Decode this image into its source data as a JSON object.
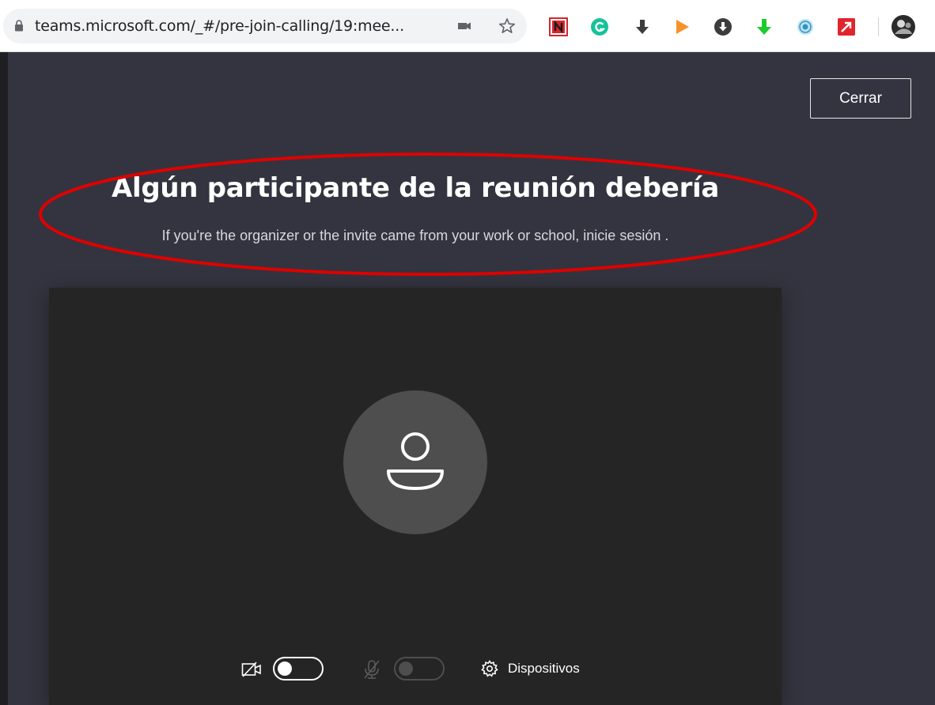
{
  "browser": {
    "url": "teams.microsoft.com/_#/pre-join-calling/19:mee...",
    "icons": [
      "lock-icon",
      "camera-icon",
      "bookmark-star-icon"
    ],
    "extensions": [
      "newsguard-icon",
      "grammarly-icon",
      "download-icon",
      "play-icon",
      "download-circle-icon",
      "green-download-icon",
      "globe-extension-icon",
      "acrobat-icon",
      "profile-avatar-icon"
    ]
  },
  "header": {
    "close_label": "Cerrar"
  },
  "prejoin": {
    "title": "Algún participante de la reunión debería",
    "subtitle_prefix": "If you're the organizer or the invite came from your work or school, ",
    "signin_link": "inicie sesión",
    "subtitle_suffix": " ."
  },
  "preview": {
    "avatar_icon": "person-icon",
    "camera_icon": "camera-off-icon",
    "camera_on": false,
    "mic_icon": "mic-off-icon",
    "mic_on": false,
    "mic_toggle_disabled": true,
    "settings_icon": "gear-icon",
    "devices_label": "Dispositivos"
  },
  "colors": {
    "page_bg": "#33343f",
    "preview_bg": "#252525",
    "avatar_bg": "#4e4e4e",
    "annotation_stroke": "#e00000"
  }
}
